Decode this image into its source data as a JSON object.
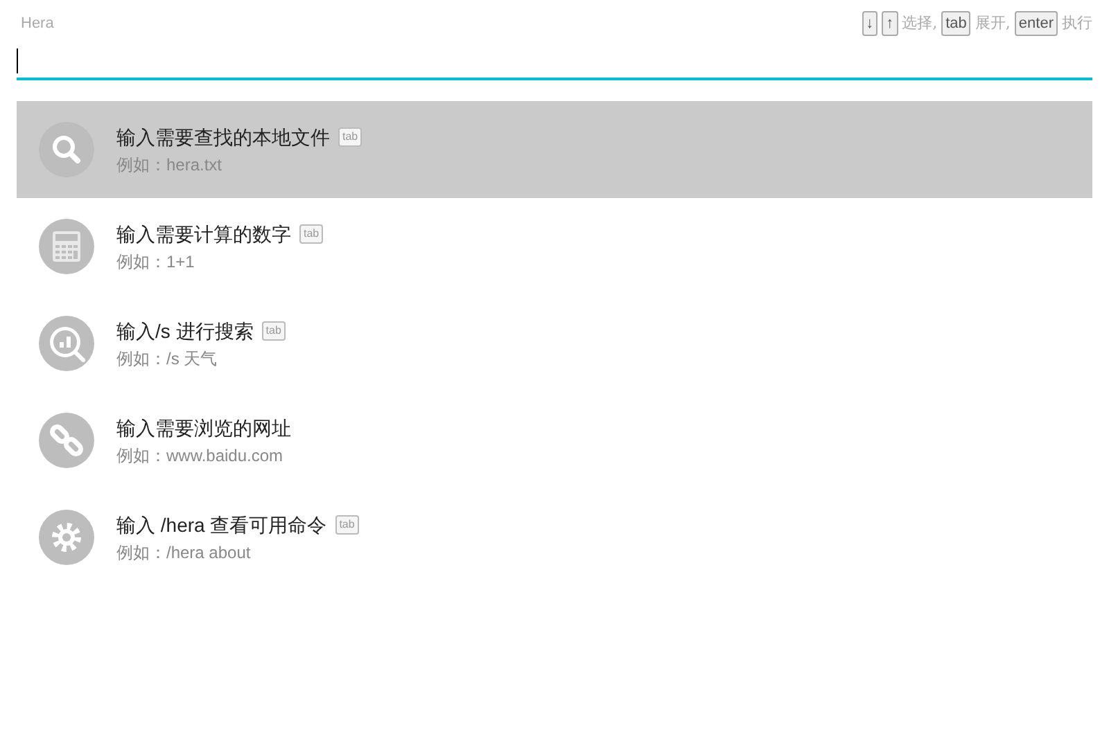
{
  "app_title": "Hera",
  "hints": [
    {
      "kind": "key",
      "text": "↓"
    },
    {
      "kind": "key",
      "text": "↑"
    },
    {
      "kind": "text",
      "text": "选择,"
    },
    {
      "kind": "key",
      "text": "tab"
    },
    {
      "kind": "text",
      "text": "展开,"
    },
    {
      "kind": "key",
      "text": "enter"
    },
    {
      "kind": "text",
      "text": "执行"
    }
  ],
  "items": [
    {
      "kind": "search",
      "title": "输入需要查找的本地文件",
      "tab_badge": "tab",
      "example": "例如：hera.txt",
      "selected": true
    },
    {
      "kind": "calculator",
      "title": "输入需要计算的数字",
      "tab_badge": "tab",
      "example": "例如：1+1",
      "selected": false
    },
    {
      "kind": "web",
      "title": "输入/s 进行搜索",
      "tab_badge": "tab",
      "example": "例如：/s 天气",
      "selected": false
    },
    {
      "kind": "link",
      "title": "输入需要浏览的网址",
      "example": "例如：www.baidu.com",
      "selected": false
    },
    {
      "kind": "command",
      "title": "输入 /hera 查看可用命令",
      "tab_badge": "tab",
      "example": "例如：/hera about",
      "selected": false
    }
  ]
}
